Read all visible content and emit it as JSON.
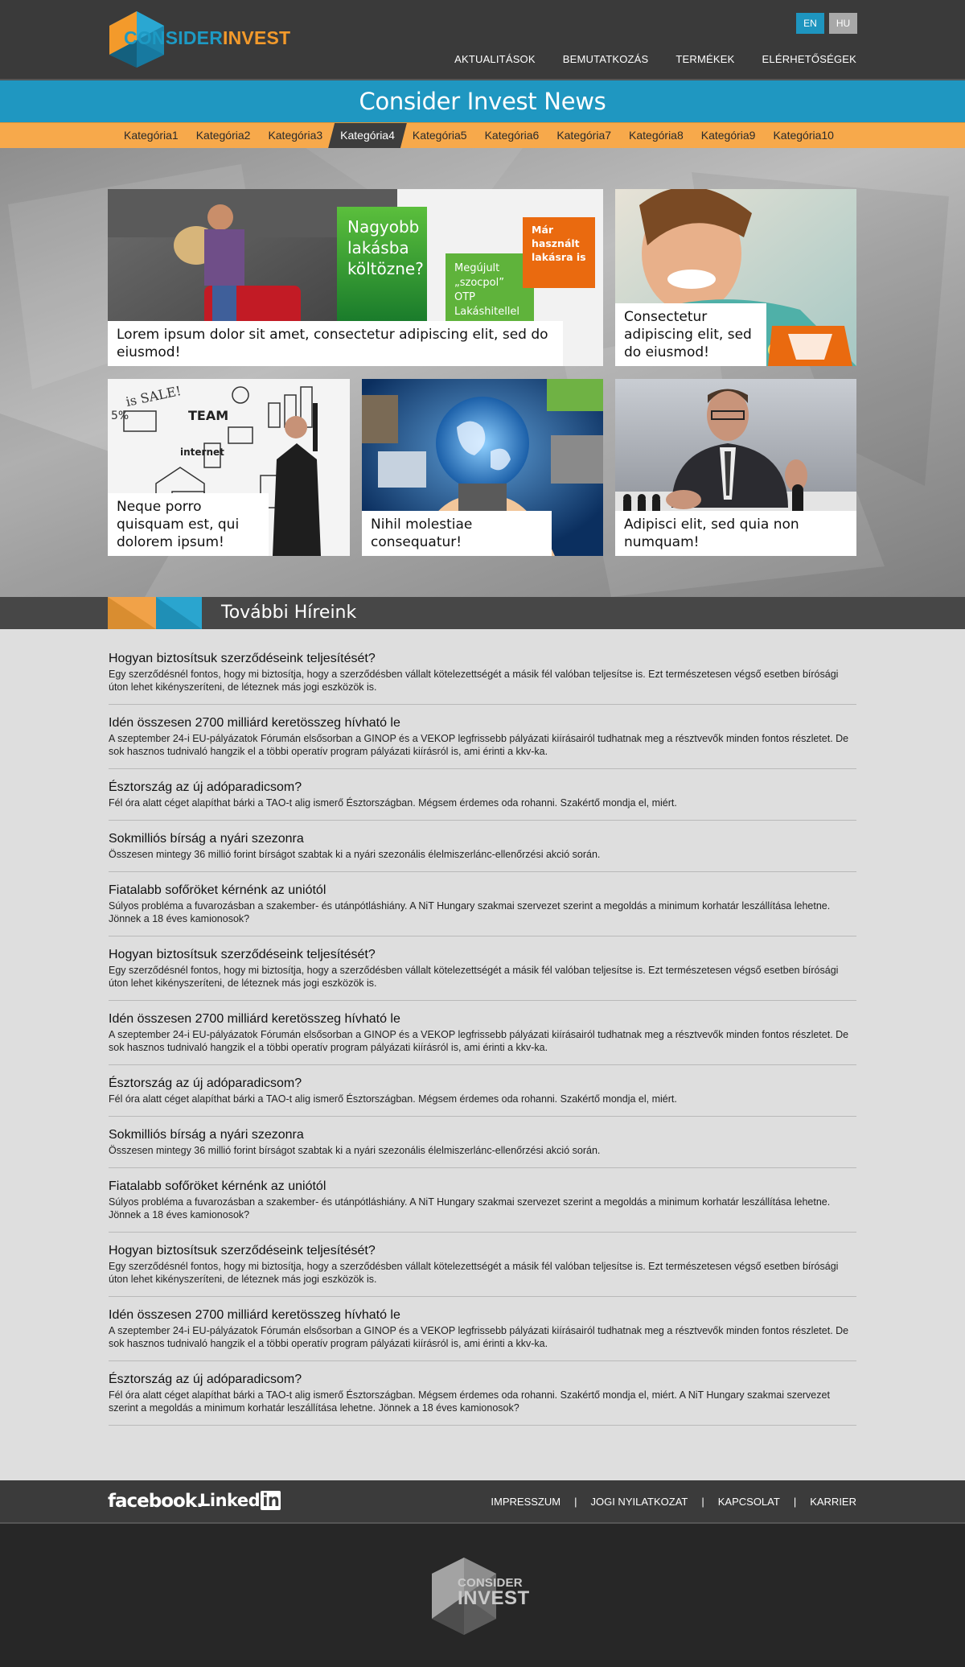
{
  "header": {
    "logo_part1": "Consider",
    "logo_part2": "Invest",
    "lang_en": "EN",
    "lang_hu": "HU",
    "nav": [
      "Aktualitások",
      "Bemutatkozás",
      "Termékek",
      "Elérhetőségek"
    ]
  },
  "news_banner": "Consider Invest News",
  "categories": [
    "Kategória1",
    "Kategória2",
    "Kategória3",
    "Kategória4",
    "Kategória5",
    "Kategória6",
    "Kategória7",
    "Kategória8",
    "Kategória9",
    "Kategória10"
  ],
  "active_category": "Kategória4",
  "feature": {
    "tile1": {
      "caption": "Lorem ipsum dolor sit amet, consectetur adipiscing elit, sed do eiusmod!",
      "ad_green": "Nagyobb lakásba költözne?",
      "ad_lightgreen": "Megújult „szocpol” OTP Lakáshitellel",
      "ad_orange": "Már használt lakásra is"
    },
    "tile2": {
      "caption": "Consectetur adipiscing elit, sed do eiusmod!"
    },
    "tile3": {
      "caption": "Neque porro quisquam est, qui dolorem ipsum!",
      "sketch_sale": "is SALE!",
      "sketch_team": "TEAM",
      "sketch_internet": "internet",
      "sketch_percent": "5%"
    },
    "tile4": {
      "caption": "Nihil molestiae consequatur!"
    },
    "tile5": {
      "caption": "Adipisci elit, sed quia non numquam!"
    }
  },
  "more_news_title": "További Híreink",
  "news": [
    {
      "title": "Hogyan biztosítsuk szerződéseink teljesítését?",
      "text": "Egy szerződésnél fontos, hogy mi biztosítja, hogy a szerződésben vállalt kötelezettségét a másik fél valóban teljesítse is. Ezt természetesen végső esetben bírósági úton lehet kikényszeríteni, de léteznek más jogi eszközök is."
    },
    {
      "title": "Idén összesen 2700 milliárd keretösszeg hívható le",
      "text": "A szeptember 24-i EU-pályázatok Fórumán elsősorban a GINOP és a VEKOP legfrissebb pályázati kiírásairól tudhatnak meg a résztvevők minden fontos részletet. De sok hasznos tudnivaló hangzik el a többi operatív program pályázati kiírásról is, ami érinti a kkv-ka."
    },
    {
      "title": "Észtország az új adóparadicsom?",
      "text": "Fél óra alatt céget alapíthat bárki a TAO-t alig ismerő Észtországban. Mégsem érdemes oda rohanni. Szakértő mondja el, miért."
    },
    {
      "title": "Sokmilliós bírság a nyári szezonra",
      "text": "Összesen mintegy 36 millió forint bírságot szabtak ki a nyári szezonális élelmiszerlánc-ellenőrzési akció során."
    },
    {
      "title": "Fiatalabb sofőröket kérnénk az uniótól",
      "text": "Súlyos probléma a fuvarozásban a szakember- és utánpótláshiány. A NiT Hungary szakmai szervezet szerint a megoldás a minimum korhatár leszállítása lehetne. Jönnek a 18 éves kamionosok?"
    },
    {
      "title": "Hogyan biztosítsuk szerződéseink teljesítését?",
      "text": "Egy szerződésnél fontos, hogy mi biztosítja, hogy a szerződésben vállalt kötelezettségét a másik fél valóban teljesítse is. Ezt természetesen végső esetben bírósági úton lehet kikényszeríteni, de léteznek más jogi eszközök is."
    },
    {
      "title": "Idén összesen 2700 milliárd keretösszeg hívható le",
      "text": "A szeptember 24-i EU-pályázatok Fórumán elsősorban a GINOP és a VEKOP legfrissebb pályázati kiírásairól tudhatnak meg a résztvevők minden fontos részletet. De sok hasznos tudnivaló hangzik el a többi operatív program pályázati kiírásról is, ami érinti a kkv-ka."
    },
    {
      "title": "Észtország az új adóparadicsom?",
      "text": "Fél óra alatt céget alapíthat bárki a TAO-t alig ismerő Észtországban. Mégsem érdemes oda rohanni. Szakértő mondja el, miért."
    },
    {
      "title": "Sokmilliós bírság a nyári szezonra",
      "text": "Összesen mintegy 36 millió forint bírságot szabtak ki a nyári szezonális élelmiszerlánc-ellenőrzési akció során."
    },
    {
      "title": "Fiatalabb sofőröket kérnénk az uniótól",
      "text": "Súlyos probléma a fuvarozásban a szakember- és utánpótláshiány. A NiT Hungary szakmai szervezet szerint a megoldás a minimum korhatár leszállítása lehetne. Jönnek a 18 éves kamionosok?"
    },
    {
      "title": "Hogyan biztosítsuk szerződéseink teljesítését?",
      "text": "Egy szerződésnél fontos, hogy mi biztosítja, hogy a szerződésben vállalt kötelezettségét a másik fél valóban teljesítse is. Ezt természetesen végső esetben bírósági úton lehet kikényszeríteni, de léteznek más jogi eszközök is."
    },
    {
      "title": "Idén összesen 2700 milliárd keretösszeg hívható le",
      "text": "A szeptember 24-i EU-pályázatok Fórumán elsősorban a GINOP és a VEKOP legfrissebb pályázati kiírásairól tudhatnak meg a résztvevők minden fontos részletet. De sok hasznos tudnivaló hangzik el a többi operatív program pályázati kiírásról is, ami érinti a kkv-ka."
    },
    {
      "title": "Észtország az új adóparadicsom?",
      "text": "Fél óra alatt céget alapíthat bárki a TAO-t alig ismerő Észtországban. Mégsem érdemes oda rohanni. Szakértő mondja el, miért. A NiT Hungary szakmai szervezet szerint a megoldás a minimum korhatár leszállítása lehetne. Jönnek a 18 éves kamionosok?"
    }
  ],
  "footer": {
    "facebook": "facebook.",
    "linkedin_part1": "Linked",
    "linkedin_part2": "in",
    "nav": [
      "Impresszum",
      "Jogi nyilatkozat",
      "Kapcsolat",
      "Karrier"
    ],
    "separator": "|",
    "logo_line1": "Consider",
    "logo_line2": "Invest"
  },
  "colors": {
    "blue": "#1f97c1",
    "orange": "#f7a94b",
    "dark": "#3a3a3a",
    "ad_orange": "#ea6a0f",
    "ad_green": "#3aa532"
  }
}
